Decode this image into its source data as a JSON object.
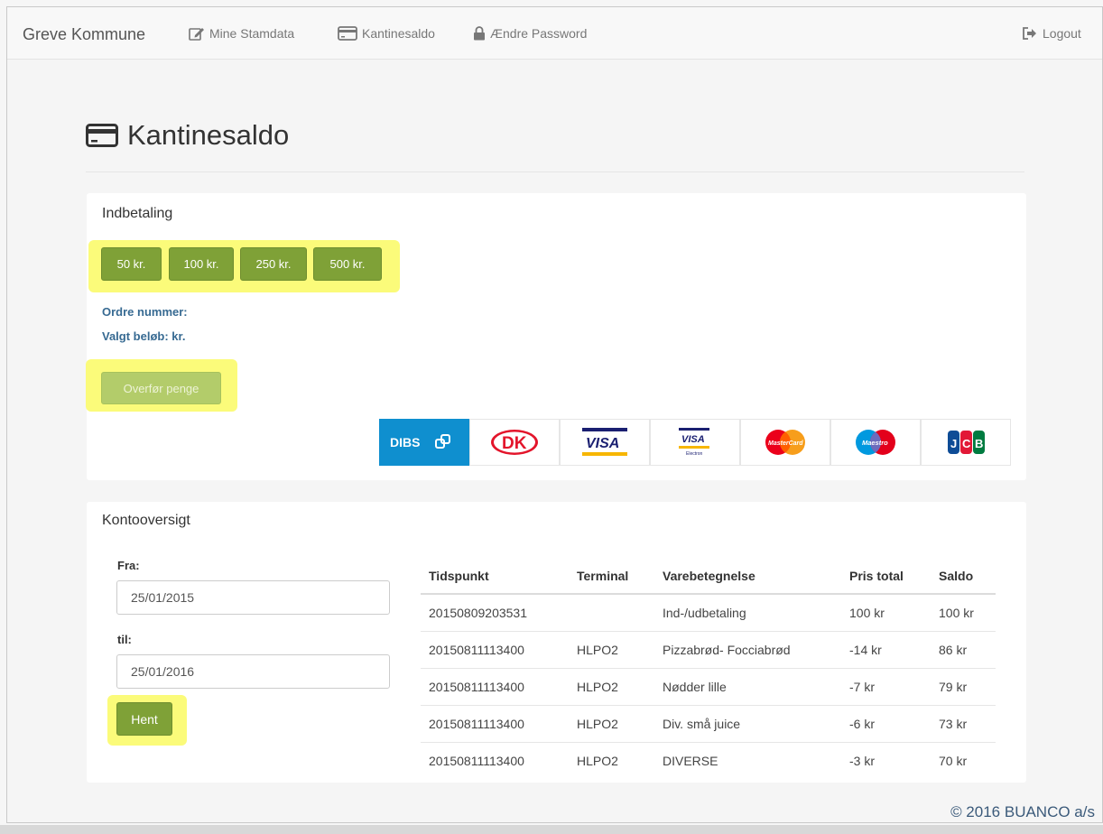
{
  "navbar": {
    "brand": "Greve Kommune",
    "items": [
      {
        "label": "Mine Stamdata",
        "icon": "edit-icon"
      },
      {
        "label": "Kantinesaldo",
        "icon": "credit-card-icon"
      },
      {
        "label": "Ændre Password",
        "icon": "lock-icon"
      }
    ],
    "logout": {
      "label": "Logout",
      "icon": "logout-icon"
    }
  },
  "page": {
    "title": "Kantinesaldo",
    "title_icon": "credit-card-icon"
  },
  "payment_panel": {
    "heading": "Indbetaling",
    "amount_buttons": [
      "50 kr.",
      "100 kr.",
      "250 kr.",
      "500 kr."
    ],
    "order_number_label": "Ordre nummer:",
    "selected_amount_label": "Valgt beløb: kr.",
    "transfer_button": "Overfør penge",
    "payment_logos": [
      "DIBS",
      "DK",
      "VISA",
      "VISA Electron",
      "MasterCard",
      "Maestro",
      "JCB"
    ]
  },
  "account_panel": {
    "heading": "Kontooversigt",
    "from_label": "Fra:",
    "from_value": "25/01/2015",
    "to_label": "til:",
    "to_value": "25/01/2016",
    "fetch_button": "Hent",
    "table": {
      "headers": [
        "Tidspunkt",
        "Terminal",
        "Varebetegnelse",
        "Pris total",
        "Saldo"
      ],
      "rows": [
        [
          "20150809203531",
          "",
          "Ind-/udbetaling",
          "100 kr",
          "100 kr"
        ],
        [
          "20150811113400",
          "HLPO2",
          "Pizzabrød- Focciabrød",
          "-14 kr",
          "86 kr"
        ],
        [
          "20150811113400",
          "HLPO2",
          "Nødder lille",
          "-7 kr",
          "79 kr"
        ],
        [
          "20150811113400",
          "HLPO2",
          "Div. små juice",
          "-6 kr",
          "73 kr"
        ],
        [
          "20150811113400",
          "HLPO2",
          "DIVERSE",
          "-3 kr",
          "70 kr"
        ]
      ]
    }
  },
  "footer": {
    "text": "© 2016 BUANCO a/s"
  },
  "colors": {
    "button_green": "#7fa137",
    "button_green_disabled": "#b3cc6a",
    "highlight_yellow": "#fbfb7a",
    "label_blue": "#376a92",
    "dibs_blue": "#0f8fcf"
  }
}
